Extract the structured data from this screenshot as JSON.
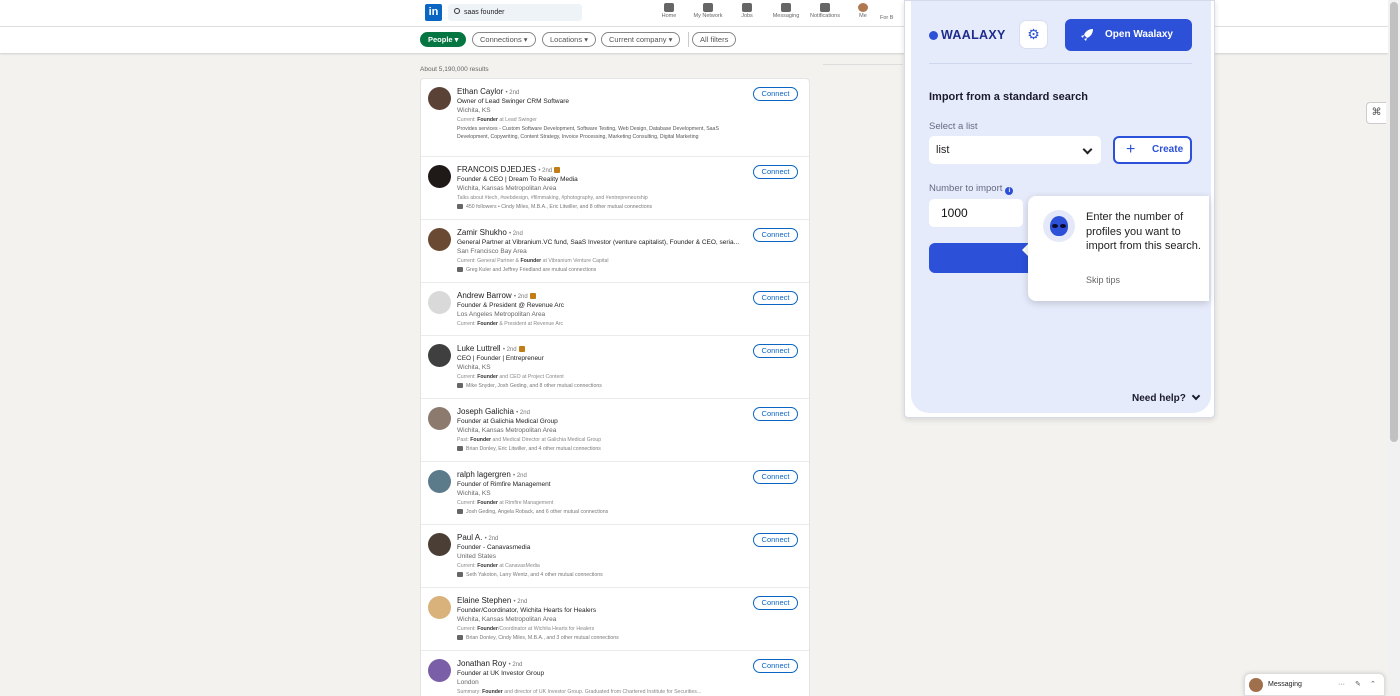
{
  "nav": {
    "search_value": "saas founder",
    "items": [
      "Home",
      "My Network",
      "Jobs",
      "Messaging",
      "Notifications",
      "Me",
      "For B"
    ]
  },
  "filters": {
    "people": "People ▾",
    "connections": "Connections ▾",
    "locations": "Locations ▾",
    "current_company": "Current company ▾",
    "all_filters": "All filters"
  },
  "results_count": "About 5,190,000 results",
  "connect_label": "Connect",
  "results": [
    {
      "name": "Ethan Caylor",
      "degree": "• 2nd",
      "premium": false,
      "headline": "Owner of Lead Swinger CRM Software",
      "location": "Wichita, KS",
      "summary_pre": "Current: ",
      "summary_bold": "Founder",
      "summary_post": " at Lead Swinger",
      "mutual": "",
      "extra": "Provides services - Custom Software Development, Software Testing, Web Design, Database Development, SaaS Development, Copywriting, Content Strategy, Invoice Processing, Marketing Consulting, Digital Marketing"
    },
    {
      "name": "FRANCOIS DJEDJES",
      "degree": "• 2nd",
      "premium": true,
      "headline": "Founder & CEO | Dream To Reality Media",
      "location": "Wichita, Kansas Metropolitan Area",
      "summary_pre": "Talks about #tech, #webdesign, #filmmaking, #photography, and #entrepreneurship",
      "summary_bold": "",
      "summary_post": "",
      "mutual": "450 followers • Cindy Miles, M.B.A., Eric Litwiller, and 8 other mutual connections",
      "extra": ""
    },
    {
      "name": "Zamir Shukho",
      "degree": "• 2nd",
      "premium": false,
      "headline": "General Partner at Vibranium.VC fund, SaaS Investor (venture capitalist), Founder & CEO, seria...",
      "location": "San Francisco Bay Area",
      "summary_pre": "Current: General Partner & ",
      "summary_bold": "Founder",
      "summary_post": " at Vibranium Venture Capital",
      "mutual": "Greg Kuler and Jeffrey Friedland are mutual connections",
      "extra": ""
    },
    {
      "name": "Andrew Barrow",
      "degree": "• 2nd",
      "premium": true,
      "headline": "Founder & President @ Revenue Arc",
      "location": "Los Angeles Metropolitan Area",
      "summary_pre": "Current: ",
      "summary_bold": "Founder",
      "summary_post": " & President at Revenue Arc",
      "mutual": "",
      "extra": ""
    },
    {
      "name": "Luke Luttrell",
      "degree": "• 2nd",
      "premium": true,
      "headline": "CEO | Founder | Entrepreneur",
      "location": "Wichita, KS",
      "summary_pre": "Current: ",
      "summary_bold": "Founder",
      "summary_post": " and CEO at Project Content",
      "mutual": "Mike Snyder, Josh Geding, and 8 other mutual connections",
      "extra": ""
    },
    {
      "name": "Joseph Galichia",
      "degree": "• 2nd",
      "premium": false,
      "headline": "Founder at Galichia Medical Group",
      "location": "Wichita, Kansas Metropolitan Area",
      "summary_pre": "Past: ",
      "summary_bold": "Founder",
      "summary_post": " and Medical Director at Galichia Medical Group",
      "mutual": "Brian Donley, Eric Litwiller, and 4 other mutual connections",
      "extra": ""
    },
    {
      "name": "ralph lagergren",
      "degree": "• 2nd",
      "premium": false,
      "headline": "Founder of Rimfire Management",
      "location": "Wichita, KS",
      "summary_pre": "Current: ",
      "summary_bold": "Founder",
      "summary_post": " at Rimfire Management",
      "mutual": "Josh Geding, Angela Roback, and 6 other mutual connections",
      "extra": ""
    },
    {
      "name": "Paul A.",
      "degree": "• 2nd",
      "premium": false,
      "headline": "Founder - Canavasmedia",
      "location": "United States",
      "summary_pre": "Current: ",
      "summary_bold": "Founder",
      "summary_post": " at CanavasMedia",
      "mutual": "Seth Yakoton, Larry Wentz, and 4 other mutual connections",
      "extra": ""
    },
    {
      "name": "Elaine Stephen",
      "degree": "• 2nd",
      "premium": false,
      "headline": "Founder/Coordinator, Wichita Hearts for Healers",
      "location": "Wichita, Kansas Metropolitan Area",
      "summary_pre": "Current: ",
      "summary_bold": "Founder",
      "summary_post": "/Coordinator at Wichita Hearts for Healers",
      "mutual": "Brian Donley, Cindy Miles, M.B.A., and 3 other mutual connections",
      "extra": ""
    },
    {
      "name": "Jonathan Roy",
      "degree": "• 2nd",
      "premium": false,
      "headline": "Founder at UK Investor Group",
      "location": "London",
      "summary_pre": "Summary: ",
      "summary_bold": "Founder",
      "summary_post": " and director of UK Investor Group. Graduated from Chartered Institute for Securities...",
      "mutual": "",
      "extra": ""
    }
  ],
  "waalaxy": {
    "logo": "WAALAXY",
    "open_button": "Open Waalaxy",
    "title": "Import from a standard search",
    "select_list_label": "Select a list",
    "selected_list": "list",
    "create_button": "Create",
    "number_label": "Number to import",
    "number_value": "1000",
    "tip_text": "Enter the number of profiles you want to import from this search.",
    "skip_tips": "Skip tips",
    "need_help": "Need help?",
    "accent_color": "#2c50d8"
  },
  "messaging": {
    "label": "Messaging",
    "controls": [
      "···",
      "✎",
      "⌃"
    ]
  }
}
